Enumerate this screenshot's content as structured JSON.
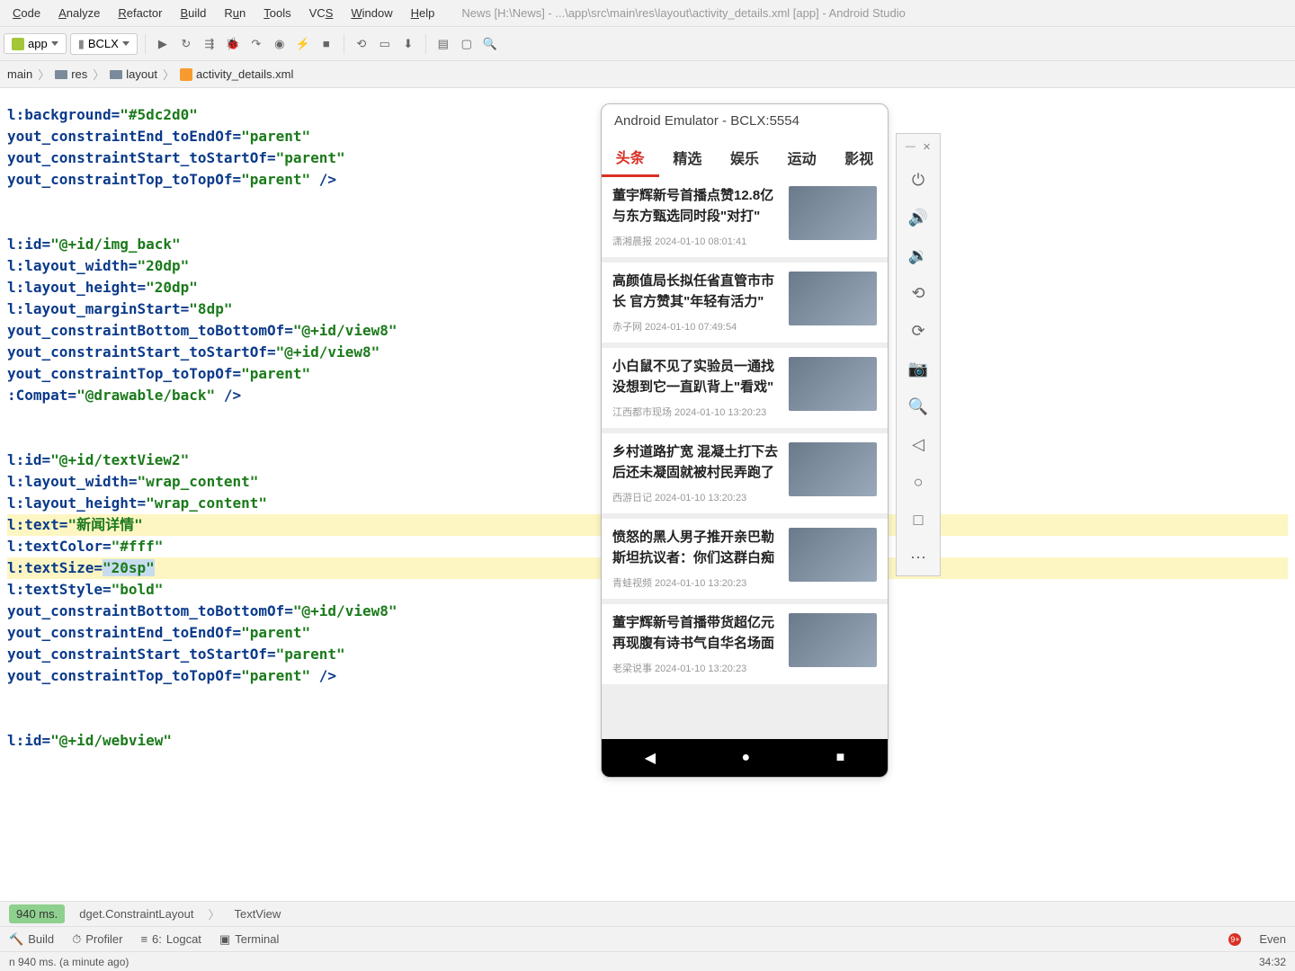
{
  "window": {
    "title": "News [H:\\News] - ...\\app\\src\\main\\res\\layout\\activity_details.xml [app] - Android Studio"
  },
  "menu": [
    "Code",
    "Analyze",
    "Refactor",
    "Build",
    "Run",
    "Tools",
    "VCS",
    "Window",
    "Help"
  ],
  "toolbar": {
    "config1": "app",
    "config2": "BCLX"
  },
  "breadcrumb": [
    "main",
    "res",
    "layout",
    "activity_details.xml"
  ],
  "code": {
    "l1a": "l:background=",
    "l1v": "\"#5dc2d0\"",
    "l2a": "yout_constraintEnd_toEndOf=",
    "l2v": "\"parent\"",
    "l3a": "yout_constraintStart_toStartOf=",
    "l3v": "\"parent\"",
    "l4a": "yout_constraintTop_toTopOf=",
    "l4v": "\"parent\"",
    "l4t": " />",
    "l6a": "l:id=",
    "l6v": "\"@+id/img_back\"",
    "l7a": "l:layout_width=",
    "l7v": "\"20dp\"",
    "l8a": "l:layout_height=",
    "l8v": "\"20dp\"",
    "l9a": "l:layout_marginStart=",
    "l9v": "\"8dp\"",
    "l10a": "yout_constraintBottom_toBottomOf=",
    "l10v": "\"@+id/view8\"",
    "l11a": "yout_constraintStart_toStartOf=",
    "l11v": "\"@+id/view8\"",
    "l12a": "yout_constraintTop_toTopOf=",
    "l12v": "\"parent\"",
    "l13a": ":Compat=",
    "l13v": "\"@drawable/back\"",
    "l13t": " />",
    "l15a": "l:id=",
    "l15v": "\"@+id/textView2\"",
    "l16a": "l:layout_width=",
    "l16v": "\"wrap_content\"",
    "l17a": "l:layout_height=",
    "l17v": "\"wrap_content\"",
    "l18a": "l:text=",
    "l18v": "\"新闻详情\"",
    "l19a": "l:textColor=",
    "l19v": "\"#fff\"",
    "l20a": "l:textSize=",
    "l20v": "\"20sp\"",
    "l21a": "l:textStyle=",
    "l21v": "\"bold\"",
    "l22a": "yout_constraintBottom_toBottomOf=",
    "l22v": "\"@+id/view8\"",
    "l23a": "yout_constraintEnd_toEndOf=",
    "l23v": "\"parent\"",
    "l24a": "yout_constraintStart_toStartOf=",
    "l24v": "\"parent\"",
    "l25a": "yout_constraintTop_toTopOf=",
    "l25v": "\"parent\"",
    "l25t": " />",
    "l27a": "l:id=",
    "l27v": "\"@+id/webview\""
  },
  "emulator": {
    "title": "Android Emulator - BCLX:5554",
    "tabs": [
      "头条",
      "精选",
      "娱乐",
      "运动",
      "影视"
    ],
    "news": [
      {
        "title": "董宇辉新号首播点赞12.8亿 与东方甄选同时段\"对打\"",
        "source": "潇湘晨报",
        "time": "2024-01-10 08:01:41"
      },
      {
        "title": "高颜值局长拟任省直管市市长 官方赞其\"年轻有活力\"",
        "source": "赤子网",
        "time": "2024-01-10 07:49:54"
      },
      {
        "title": "小白鼠不见了实验员一通找 没想到它一直趴背上\"看戏\"",
        "source": "江西都市现场",
        "time": "2024-01-10 13:20:23"
      },
      {
        "title": "乡村道路扩宽 混凝土打下去后还未凝固就被村民弄跑了",
        "source": "西游日记",
        "time": "2024-01-10 13:20:23"
      },
      {
        "title": "愤怒的黑人男子推开亲巴勒斯坦抗议者：你们这群白痴",
        "source": "青蛙视频",
        "time": "2024-01-10 13:20:23"
      },
      {
        "title": "董宇辉新号首播带货超亿元 再现腹有诗书气自华名场面",
        "source": "老梁说事",
        "time": "2024-01-10 13:20:23"
      }
    ]
  },
  "bottom": {
    "badge": "940 ms.",
    "crumb1": "dget.ConstraintLayout",
    "crumb2": "TextView",
    "tabs": [
      "Build",
      "Profiler",
      "Logcat",
      "Terminal"
    ],
    "tab_prefixes": [
      "",
      "",
      "6: ",
      ""
    ],
    "event": "Even",
    "status": "n 940 ms. (a minute ago)",
    "pos": "34:32"
  }
}
